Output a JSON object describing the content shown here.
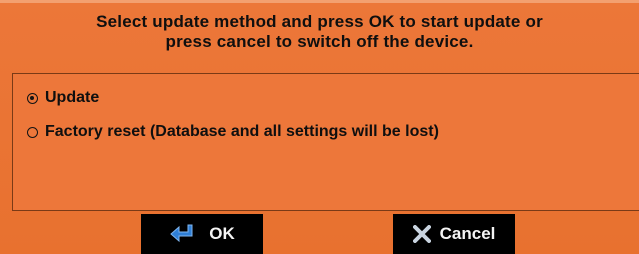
{
  "dialog": {
    "message_line1": "Select update method and press OK to start update or",
    "message_line2": "press cancel to switch off the device."
  },
  "options": [
    {
      "label": "Update",
      "selected": true
    },
    {
      "label": "Factory reset (Database and all settings will be lost)",
      "selected": false
    }
  ],
  "buttons": {
    "ok": {
      "label": "OK",
      "icon": "enter-arrow-icon",
      "icon_color": "#2f7fd6"
    },
    "cancel": {
      "label": "Cancel",
      "icon": "close-x-icon",
      "icon_color": "#c9d4e0"
    }
  },
  "colors": {
    "background": "#ea7335",
    "button": "#000000",
    "text": "#0f0f0f"
  }
}
